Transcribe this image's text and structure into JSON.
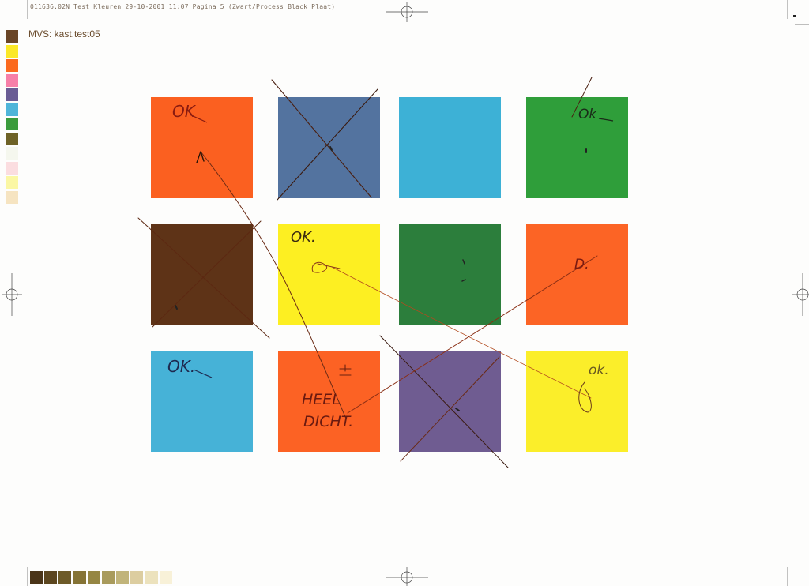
{
  "print_header": {
    "prefix": "011636.02N Test Kleuren 29-10-2001 11:07 Pagina 5",
    "suffix": " (Zwart/Process Black Plaat)",
    "faded": "Plaat)"
  },
  "title": "MVS: kast.test05",
  "side_swatches": [
    "#6a4526",
    "#fbe827",
    "#fb6a1e",
    "#f77fa8",
    "#6a5c94",
    "#4fb5d9",
    "#3a9b3c",
    "#6e6226",
    "#f5f7ee",
    "#fbdde0",
    "#fbf7a4",
    "#f6e4c1"
  ],
  "bottom_swatches": [
    "#4a3418",
    "#5c461f",
    "#6d5a28",
    "#857335",
    "#958643",
    "#a99b5c",
    "#c1b47a",
    "#dccda0",
    "#ece2bd",
    "#f8f1d8"
  ],
  "tiles": [
    {
      "color": "#fb6020"
    },
    {
      "color": "#53739f"
    },
    {
      "color": "#3db1d6"
    },
    {
      "color": "#2f9e3a"
    },
    {
      "color": "#5e3317"
    },
    {
      "color": "#fdef22"
    },
    {
      "color": "#2c7e3c"
    },
    {
      "color": "#fc6425"
    },
    {
      "color": "#46b2d7"
    },
    {
      "color": "#fc6224"
    },
    {
      "color": "#6f5c91"
    },
    {
      "color": "#fbee2a"
    }
  ],
  "annotations": {
    "ok_1": "OK",
    "ok_2": "Ok",
    "ok_3": "OK.",
    "ok_4": "OK.",
    "ok_5": "ok.",
    "d_mark": "D.",
    "heel": "HEEL",
    "dicht": "DICHT."
  }
}
